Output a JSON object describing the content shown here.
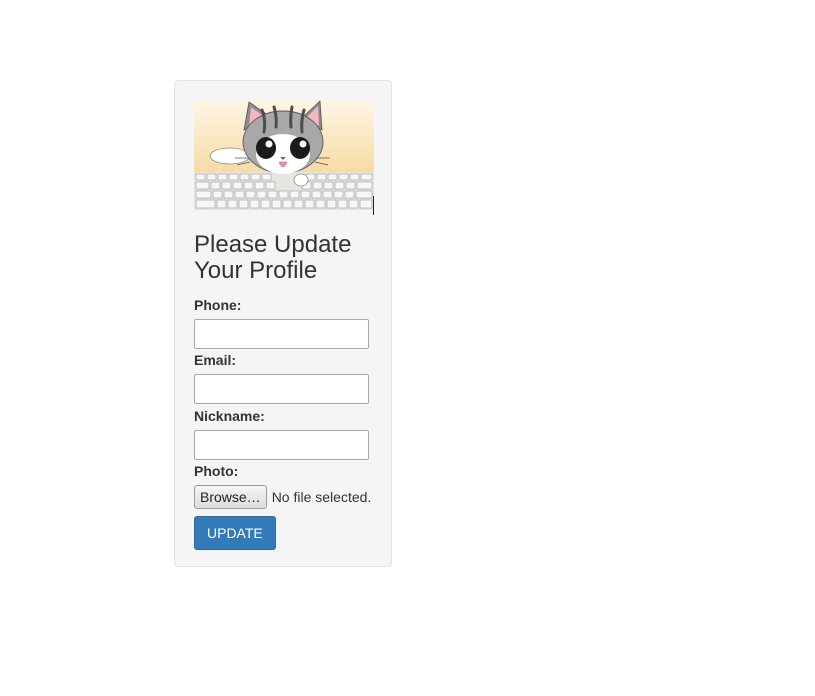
{
  "profile_form": {
    "image_alt": "cat on keyboard",
    "title": "Please Update Your Profile",
    "phone_label": "Phone:",
    "phone_value": "",
    "email_label": "Email:",
    "email_value": "",
    "nickname_label": "Nickname:",
    "nickname_value": "",
    "photo_label": "Photo:",
    "browse_label": "Browse…",
    "file_status": "No file selected.",
    "submit_label": "UPDATE"
  },
  "colors": {
    "panel_bg": "#f5f5f5",
    "panel_border": "#e3e3e3",
    "primary_button": "#337ab7",
    "text": "#333333"
  }
}
